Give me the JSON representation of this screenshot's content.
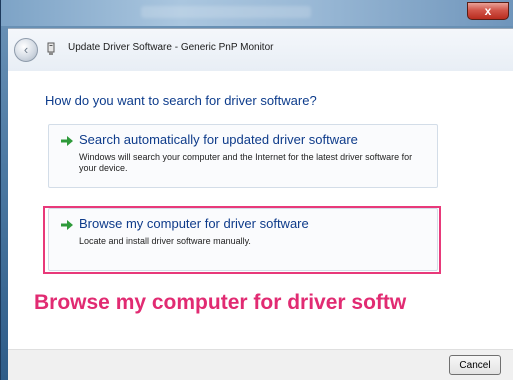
{
  "window": {
    "close_label": "x"
  },
  "nav": {
    "back_label": "‹",
    "title": "Update Driver Software - Generic PnP Monitor"
  },
  "main": {
    "heading": "How do you want to search for driver software?",
    "options": [
      {
        "title": "Search automatically for updated driver software",
        "description": "Windows will search your computer and the Internet for the latest driver software for your device."
      },
      {
        "title": "Browse my computer for driver software",
        "description": "Locate and install driver software manually."
      }
    ]
  },
  "caption": "Browse my computer for driver softw",
  "footer": {
    "cancel_label": "Cancel"
  },
  "colors": {
    "accent": "#e8397a",
    "link_blue": "#0e3b8a",
    "arrow_green": "#2e9a3a"
  },
  "icons": {
    "back": "back-arrow-icon",
    "device": "monitor-device-icon",
    "option_arrow": "green-arrow-icon",
    "close": "close-icon"
  }
}
